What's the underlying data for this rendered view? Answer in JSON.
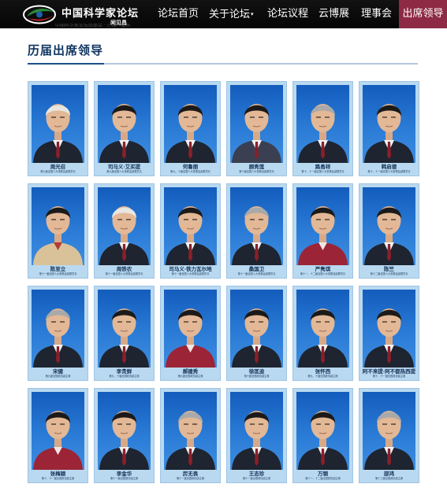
{
  "header": {
    "logo_title": "中国科学家论坛",
    "logo_subtitle": "闻见昌",
    "sub_line": "中国科学家论坛组委会 · 历届 · 嘉宾",
    "nav": [
      {
        "label": "论坛首页",
        "dropdown": false,
        "active": false
      },
      {
        "label": "关于论坛",
        "dropdown": true,
        "active": false
      },
      {
        "label": "论坛议程",
        "dropdown": false,
        "active": false
      },
      {
        "label": "云博展",
        "dropdown": false,
        "active": false
      },
      {
        "label": "理事会",
        "dropdown": false,
        "active": false
      },
      {
        "label": "出席领导",
        "dropdown": false,
        "active": true
      }
    ]
  },
  "page": {
    "title": "历届出席领导"
  },
  "colors": {
    "nav_active": "#8f2a44",
    "title": "#0f3561",
    "card_bg": "#b9d9f0",
    "photo_bg": "#135cbd"
  },
  "leaders": [
    {
      "name": "周光召",
      "caption": "第九届全国人大常委会副委员长",
      "hair": "white",
      "attire": "dark-suit"
    },
    {
      "name": "司马义·艾买提",
      "caption": "第九届全国人大常委会副委员长",
      "hair": "dark",
      "attire": "dark-suit"
    },
    {
      "name": "何鲁丽",
      "caption": "第九、十届全国人大常委会副委员长",
      "hair": "dark",
      "attire": "dark-suit"
    },
    {
      "name": "顾秀莲",
      "caption": "第十届全国人大常委会副委员长",
      "hair": "dark",
      "attire": "patterned"
    },
    {
      "name": "路甬祥",
      "caption": "第十、十一届全国人大常委会副委员长",
      "hair": "gray",
      "attire": "dark-suit"
    },
    {
      "name": "韩启德",
      "caption": "第十、十一届全国人大常委会副委员长",
      "hair": "dark",
      "attire": "dark-suit"
    },
    {
      "name": "陈至立",
      "caption": "第十一届全国人大常委会副委员长",
      "hair": "dark",
      "attire": "beige"
    },
    {
      "name": "周铁农",
      "caption": "第十一届全国人大常委会副委员长",
      "hair": "white",
      "attire": "dark-suit"
    },
    {
      "name": "司马义·铁力瓦尔地",
      "caption": "第十一届全国人大常委会副委员长",
      "hair": "dark",
      "attire": "dark-suit"
    },
    {
      "name": "桑国卫",
      "caption": "第十一届全国人大常委会副委员长",
      "hair": "gray",
      "attire": "dark-suit"
    },
    {
      "name": "严隽琪",
      "caption": "第十一、十二届全国人大常委会副委员长",
      "hair": "dark",
      "attire": "red"
    },
    {
      "name": "陈竺",
      "caption": "第十二届全国人大常委会副委员长",
      "hair": "dark",
      "attire": "dark-suit"
    },
    {
      "name": "宋健",
      "caption": "第九届全国政协副主席",
      "hair": "gray",
      "attire": "dark-suit"
    },
    {
      "name": "李贵鲜",
      "caption": "第九、十届全国政协副主席",
      "hair": "dark",
      "attire": "dark-suit"
    },
    {
      "name": "郝建秀",
      "caption": "第九届全国政协副主席",
      "hair": "dark",
      "attire": "red"
    },
    {
      "name": "徐匡迪",
      "caption": "第十届全国政协副主席",
      "hair": "dark",
      "attire": "dark-suit"
    },
    {
      "name": "张怀西",
      "caption": "第九、十届全国政协副主席",
      "hair": "dark",
      "attire": "dark-suit"
    },
    {
      "name": "阿不来提·阿不都热西提",
      "caption": "第十、十一届全国政协副主席",
      "hair": "dark",
      "attire": "dark-suit"
    },
    {
      "name": "张梅颖",
      "caption": "第十、十一届全国政协副主席",
      "hair": "dark",
      "attire": "red"
    },
    {
      "name": "李金华",
      "caption": "第十一届全国政协副主席",
      "hair": "dark",
      "attire": "dark-suit"
    },
    {
      "name": "厉无畏",
      "caption": "第十一届全国政协副主席",
      "hair": "gray",
      "attire": "dark-suit"
    },
    {
      "name": "王志珍",
      "caption": "第十一届全国政协副主席",
      "hair": "dark",
      "attire": "dark-suit"
    },
    {
      "name": "万钢",
      "caption": "第十一、十二届全国政协副主席",
      "hair": "dark",
      "attire": "dark-suit"
    },
    {
      "name": "邵鸿",
      "caption": "第十三届全国政协副主席",
      "hair": "gray",
      "attire": "dark-suit"
    }
  ]
}
